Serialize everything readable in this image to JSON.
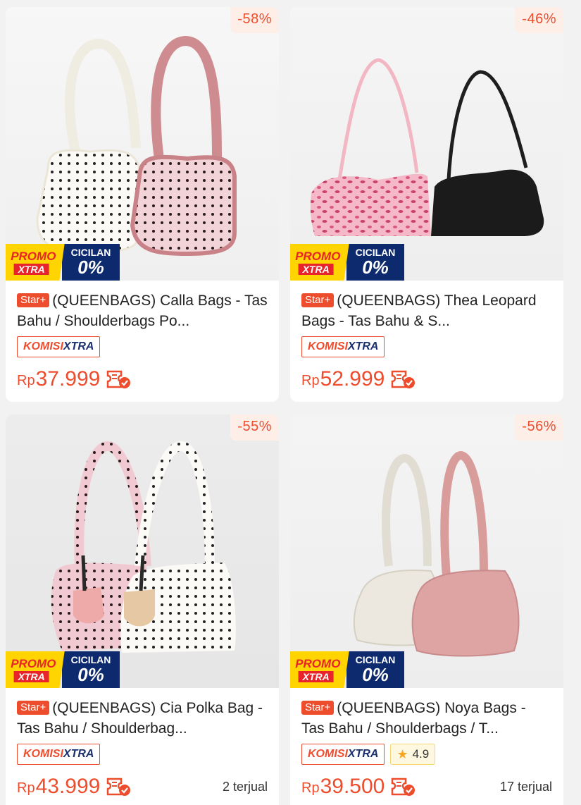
{
  "products": [
    {
      "discount": "-58%",
      "promo_top": "PROMO",
      "promo_bottom": "XTRA",
      "cicilan": "CICILAN",
      "cicilan_rate": "0%",
      "star_label": "Star+",
      "title": "(QUEENBAGS) Calla Bags - Tas Bahu / Shoulderbags Po...",
      "komisi_a": "KOMISI",
      "komisi_b": "XTRA",
      "currency": "Rp",
      "price": "37.999",
      "rating": "",
      "sold": ""
    },
    {
      "discount": "-46%",
      "promo_top": "PROMO",
      "promo_bottom": "XTRA",
      "cicilan": "CICILAN",
      "cicilan_rate": "0%",
      "star_label": "Star+",
      "title": "(QUEENBAGS) Thea Leopard Bags - Tas Bahu & S...",
      "komisi_a": "KOMISI",
      "komisi_b": "XTRA",
      "currency": "Rp",
      "price": "52.999",
      "rating": "",
      "sold": ""
    },
    {
      "discount": "-55%",
      "promo_top": "PROMO",
      "promo_bottom": "XTRA",
      "cicilan": "CICILAN",
      "cicilan_rate": "0%",
      "star_label": "Star+",
      "title": "(QUEENBAGS) Cia Polka Bag - Tas Bahu / Shoulderbag...",
      "komisi_a": "KOMISI",
      "komisi_b": "XTRA",
      "currency": "Rp",
      "price": "43.999",
      "rating": "",
      "sold": "2 terjual"
    },
    {
      "discount": "-56%",
      "promo_top": "PROMO",
      "promo_bottom": "XTRA",
      "cicilan": "CICILAN",
      "cicilan_rate": "0%",
      "star_label": "Star+",
      "title": "(QUEENBAGS) Noya Bags - Tas Bahu / Shoulderbags / T...",
      "komisi_a": "KOMISI",
      "komisi_b": "XTRA",
      "currency": "Rp",
      "price": "39.500",
      "rating": "4.9",
      "sold": "17 terjual"
    }
  ],
  "colors": {
    "accent": "#ee4d2d",
    "promo_yellow": "#ffd400",
    "cicilan_navy": "#0d2a6e"
  },
  "icons": {
    "rating": "star-icon",
    "cod": "cod-check-icon"
  }
}
